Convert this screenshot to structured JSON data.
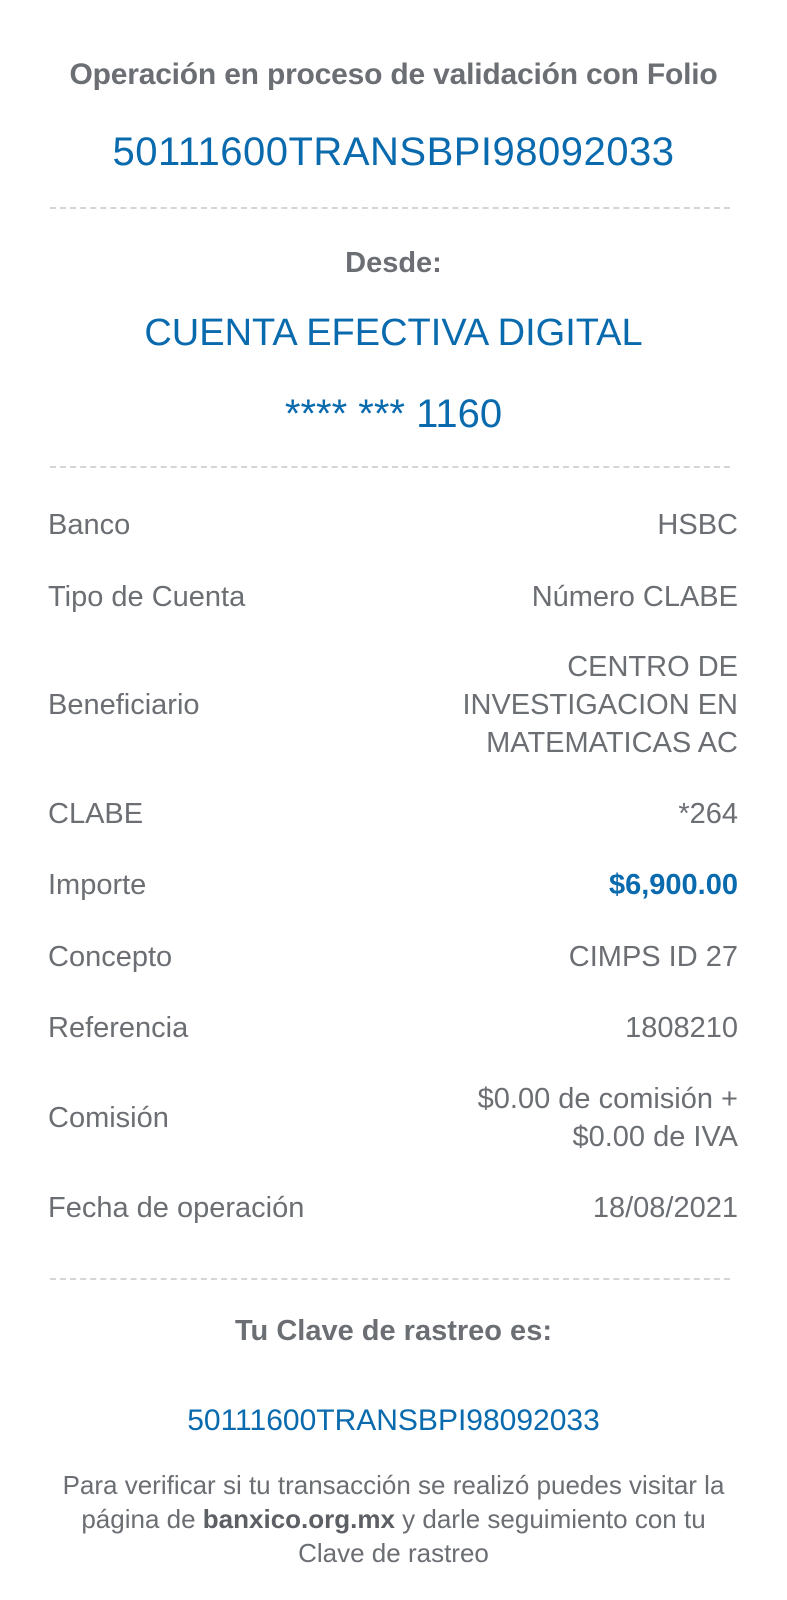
{
  "header": {
    "folio_heading": "Operación en proceso de validación con Folio",
    "folio_number": "50111600TRANSBPI98092033"
  },
  "origin": {
    "label": "Desde:",
    "account_name": "CUENTA EFECTIVA DIGITAL",
    "account_number": "**** *** 1160"
  },
  "details": {
    "banco": {
      "label": "Banco",
      "value": "HSBC"
    },
    "tipo_cuenta": {
      "label": "Tipo de Cuenta",
      "value": "Número CLABE"
    },
    "beneficiario": {
      "label": "Beneficiario",
      "value_line1": "CENTRO DE",
      "value_line2": "INVESTIGACION EN",
      "value_line3": "MATEMATICAS AC"
    },
    "clabe": {
      "label": "CLABE",
      "value": "*264"
    },
    "importe": {
      "label": "Importe",
      "value": "$6,900.00"
    },
    "concepto": {
      "label": "Concepto",
      "value": "CIMPS ID 27"
    },
    "referencia": {
      "label": "Referencia",
      "value": "1808210"
    },
    "comision": {
      "label": "Comisión",
      "value_line1": "$0.00 de comisión +",
      "value_line2": "$0.00 de IVA"
    },
    "fecha": {
      "label": "Fecha de operación",
      "value": "18/08/2021"
    }
  },
  "tracking": {
    "heading": "Tu Clave de rastreo es:",
    "number": "50111600TRANSBPI98092033",
    "verify_part1": "Para verificar si tu transacción se realizó puedes visitar la página de ",
    "verify_link": "banxico.org.mx",
    "verify_part2": " y darle seguimiento con tu Clave de rastreo"
  }
}
